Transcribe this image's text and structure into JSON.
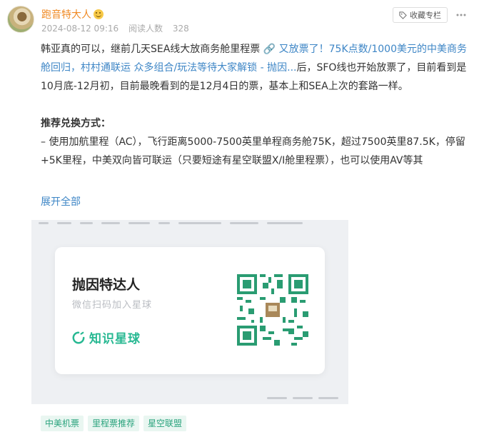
{
  "post": {
    "author": "跑音特大人",
    "date": "2024-08-12 09:16",
    "read_label": "阅读人数",
    "read_count": "328",
    "follow_label": "收藏专栏",
    "more_icon": "more-dots-icon"
  },
  "content": {
    "p1_a": "韩亚真的可以，继前几天SEA线大放商务舱里程票 ",
    "p1_link": "🔗 又放票了！75K点数/1000美元的中美商务舱回归，村村通联运 众多组合/玩法等待大家解锁 - 抛因...",
    "p1_b": "后，SFO线也开始放票了，目前看到是10月底-12月初，目前最晚看到的是12月4日的票，基本上和SEA上次的套路一样。",
    "p2_heading": "推荐兑换方式：",
    "p2_body": "– 使用加航里程（AC），飞行距离5000-7500英里单程商务舱75K，超过7500英里87.5K，停留+5K里程，中美双向皆可联运（只要短途有星空联盟X/I舱里程票），也可以使用AV等其",
    "expand_label": "展开全部"
  },
  "poster": {
    "title": "抛因特达人",
    "subtitle": "微信扫码加入星球",
    "brand": "知识星球"
  },
  "tags": [
    "中美机票",
    "里程票推荐",
    "星空联盟"
  ],
  "colors": {
    "author": "#f08a24",
    "link": "#3e86c6",
    "brand_green": "#27b892",
    "tag_bg": "#e9f6f1",
    "tag_text": "#2aa37d"
  }
}
